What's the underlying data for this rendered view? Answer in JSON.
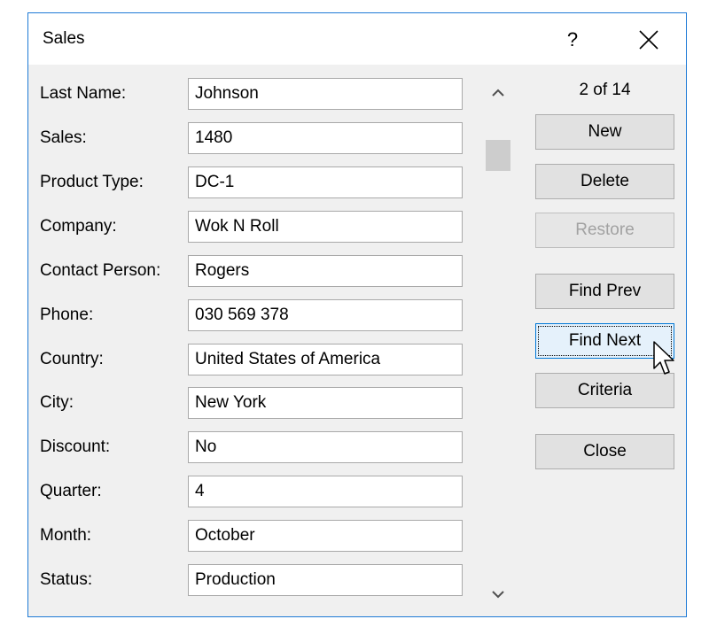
{
  "window": {
    "title": "Sales",
    "help_label": "?"
  },
  "fields": [
    {
      "label": "Last Name:",
      "value": "Johnson"
    },
    {
      "label": "Sales:",
      "value": "1480"
    },
    {
      "label": "Product Type:",
      "value": "DC-1"
    },
    {
      "label": "Company:",
      "value": "Wok N Roll"
    },
    {
      "label": "Contact Person:",
      "value": "Rogers"
    },
    {
      "label": "Phone:",
      "value": "030 569 378"
    },
    {
      "label": "Country:",
      "value": "United States of America"
    },
    {
      "label": "City:",
      "value": "New York"
    },
    {
      "label": "Discount:",
      "value": "No"
    },
    {
      "label": "Quarter:",
      "value": "4"
    },
    {
      "label": "Month:",
      "value": "October"
    },
    {
      "label": "Status:",
      "value": "Production"
    }
  ],
  "record_position": "2 of 14",
  "buttons": {
    "new": "New",
    "delete": "Delete",
    "restore": "Restore",
    "find_prev": "Find Prev",
    "find_next": "Find Next",
    "criteria": "Criteria",
    "close": "Close"
  },
  "colors": {
    "accent": "#1e7ad6",
    "dialog_bg": "#f0f0f0",
    "disabled_text": "#a2a2a2"
  }
}
